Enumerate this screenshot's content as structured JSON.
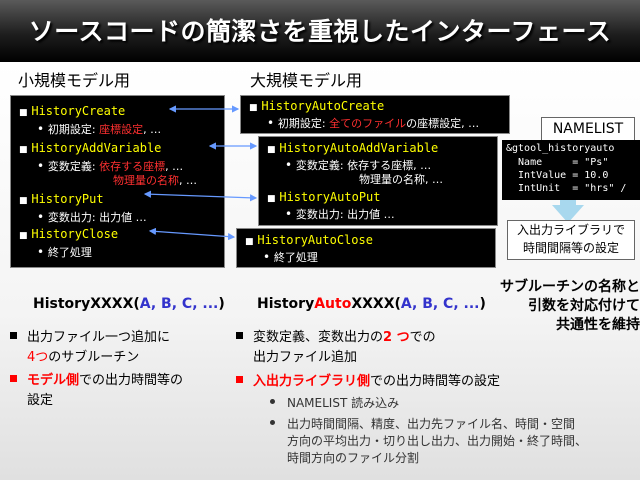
{
  "title": "ソースコードの簡潔さを重視したインターフェース",
  "left_heading": "小規模モデル用",
  "right_heading": "大規模モデル用",
  "left_box": {
    "create": "HistoryCreate",
    "create_sub_label": "初期設定: ",
    "create_sub_red": "座標設定",
    "create_sub_tail": ", …",
    "addvar": "HistoryAddVariable",
    "addvar_sub_label": "変数定義: ",
    "addvar_sub_red1": "依存する座標",
    "addvar_sub_tail1": ", …",
    "addvar_sub_red2": "物理量の名称",
    "addvar_sub_tail2": ", …",
    "put": "HistoryPut",
    "put_sub": "変数出力: 出力値 …",
    "close": "HistoryClose",
    "close_sub": "終了処理"
  },
  "right_box": {
    "create": "HistoryAutoCreate",
    "create_sub_label": "初期設定: ",
    "create_sub_red": "全てのファイル",
    "create_sub_tail": "の座標設定, …",
    "addvar": "HistoryAutoAddVariable",
    "addvar_sub1": "変数定義: 依存する座標, …",
    "addvar_sub2": "物理量の名称, …",
    "put": "HistoryAutoPut",
    "put_sub": "変数出力: 出力値 …",
    "close": "HistoryAutoClose",
    "close_sub": "終了処理"
  },
  "namelist": {
    "label": "NAMELIST",
    "lines": [
      "&gtool_historyauto",
      "  Name     = \"Ps\"",
      "  IntValue = 10.0",
      "  IntUnit  = \"hrs\" /"
    ]
  },
  "library_box": {
    "line1": "入出力ライブラリで",
    "line2": "時間間隔等の設定"
  },
  "left_sig": {
    "prefix": "HistoryXXXX(",
    "args": "A, B, C, ...",
    "suffix": ")"
  },
  "right_sig": {
    "prefix": "History",
    "auto": "Auto",
    "mid": "XXXX(",
    "args": "A, B, C, ...",
    "suffix": ")"
  },
  "note": {
    "line1": "サブルーチンの名称と",
    "line2": "引数を対応付けて",
    "line3": "共通性を維持"
  },
  "left_bullets": {
    "b1_line1": "出力ファイル一つ追加に",
    "b1_line2_red": "4つ",
    "b1_line2_tail": "のサブルーチン",
    "b2_red": "モデル側",
    "b2_tail": "での出力時間等の",
    "b2_line2": "設定"
  },
  "right_bullets": {
    "b1_line1_head": "変数定義、変数出力の",
    "b1_line1_red": "2 つ",
    "b1_line1_tail": "での",
    "b1_line2": "出力ファイル追加",
    "b2_red": "入出力ライブラリ側",
    "b2_tail": "での出力時間等の設定",
    "s1": "NAMELIST 読み込み",
    "s2_line1": "出力時間間隔、精度、出力先ファイル名、時間・空間",
    "s2_line2": "方向の平均出力・切り出し出力、出力開始・終了時間、",
    "s2_line3": "時間方向のファイル分割"
  },
  "colors": {
    "code_yellow": "#ffff00",
    "accent_red": "#ff0000",
    "accent_blue": "#3333cc",
    "connector": "#6699ff",
    "arrow_fill": "#a8d8ee"
  }
}
